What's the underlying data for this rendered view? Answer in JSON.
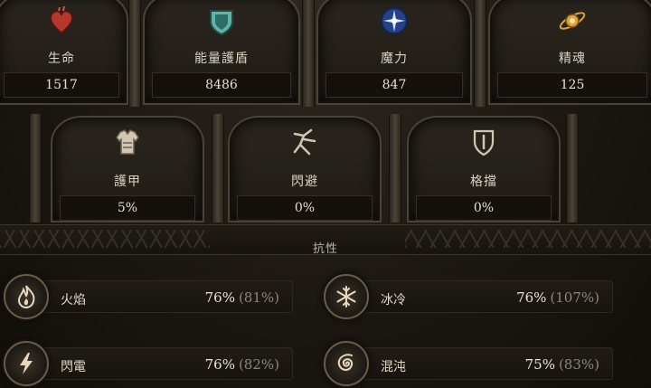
{
  "top_stats": [
    {
      "label": "生命",
      "value": "1517",
      "icon": "heart-icon"
    },
    {
      "label": "能量護盾",
      "value": "8486",
      "icon": "energy-shield-icon"
    },
    {
      "label": "魔力",
      "value": "847",
      "icon": "mana-icon"
    },
    {
      "label": "精魂",
      "value": "125",
      "icon": "spirit-icon"
    }
  ],
  "defense_stats": [
    {
      "label": "護甲",
      "value": "5%",
      "icon": "armour-icon"
    },
    {
      "label": "閃避",
      "value": "0%",
      "icon": "evasion-icon"
    },
    {
      "label": "格擋",
      "value": "0%",
      "icon": "block-shield-icon"
    }
  ],
  "resistances": {
    "title": "抗性",
    "items": [
      {
        "name": "火焰",
        "value": "76%",
        "max": "(81%)",
        "icon": "fire-icon"
      },
      {
        "name": "冰冷",
        "value": "76%",
        "max": "(107%)",
        "icon": "cold-snowflake-icon"
      },
      {
        "name": "閃電",
        "value": "76%",
        "max": "(82%)",
        "icon": "lightning-icon"
      },
      {
        "name": "混沌",
        "value": "75%",
        "max": "(83%)",
        "icon": "chaos-spiral-icon"
      }
    ]
  },
  "colors": {
    "life": "#c0392b",
    "energy_shield": "#5fb3a8",
    "mana": "#3c6fd1",
    "spirit": "#e0a53a",
    "text": "#d9cfbf",
    "frame": "#4a4236"
  }
}
